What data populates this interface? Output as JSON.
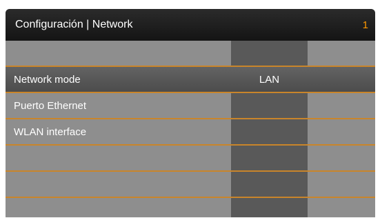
{
  "header": {
    "title": "Configuración | Network",
    "page_indicator": "1"
  },
  "rows": [
    {
      "label": "",
      "value": ""
    },
    {
      "label": "Network mode",
      "value": "LAN"
    },
    {
      "label": "Puerto Ethernet",
      "value": ""
    },
    {
      "label": "WLAN interface",
      "value": ""
    },
    {
      "label": "",
      "value": ""
    },
    {
      "label": "",
      "value": ""
    },
    {
      "label": "",
      "value": ""
    }
  ],
  "colors": {
    "title_background": "#1c1c1c",
    "accent": "#ff9800",
    "divider": "#c9852a",
    "panel": "#8e8e8e",
    "value_column": "#595959"
  }
}
